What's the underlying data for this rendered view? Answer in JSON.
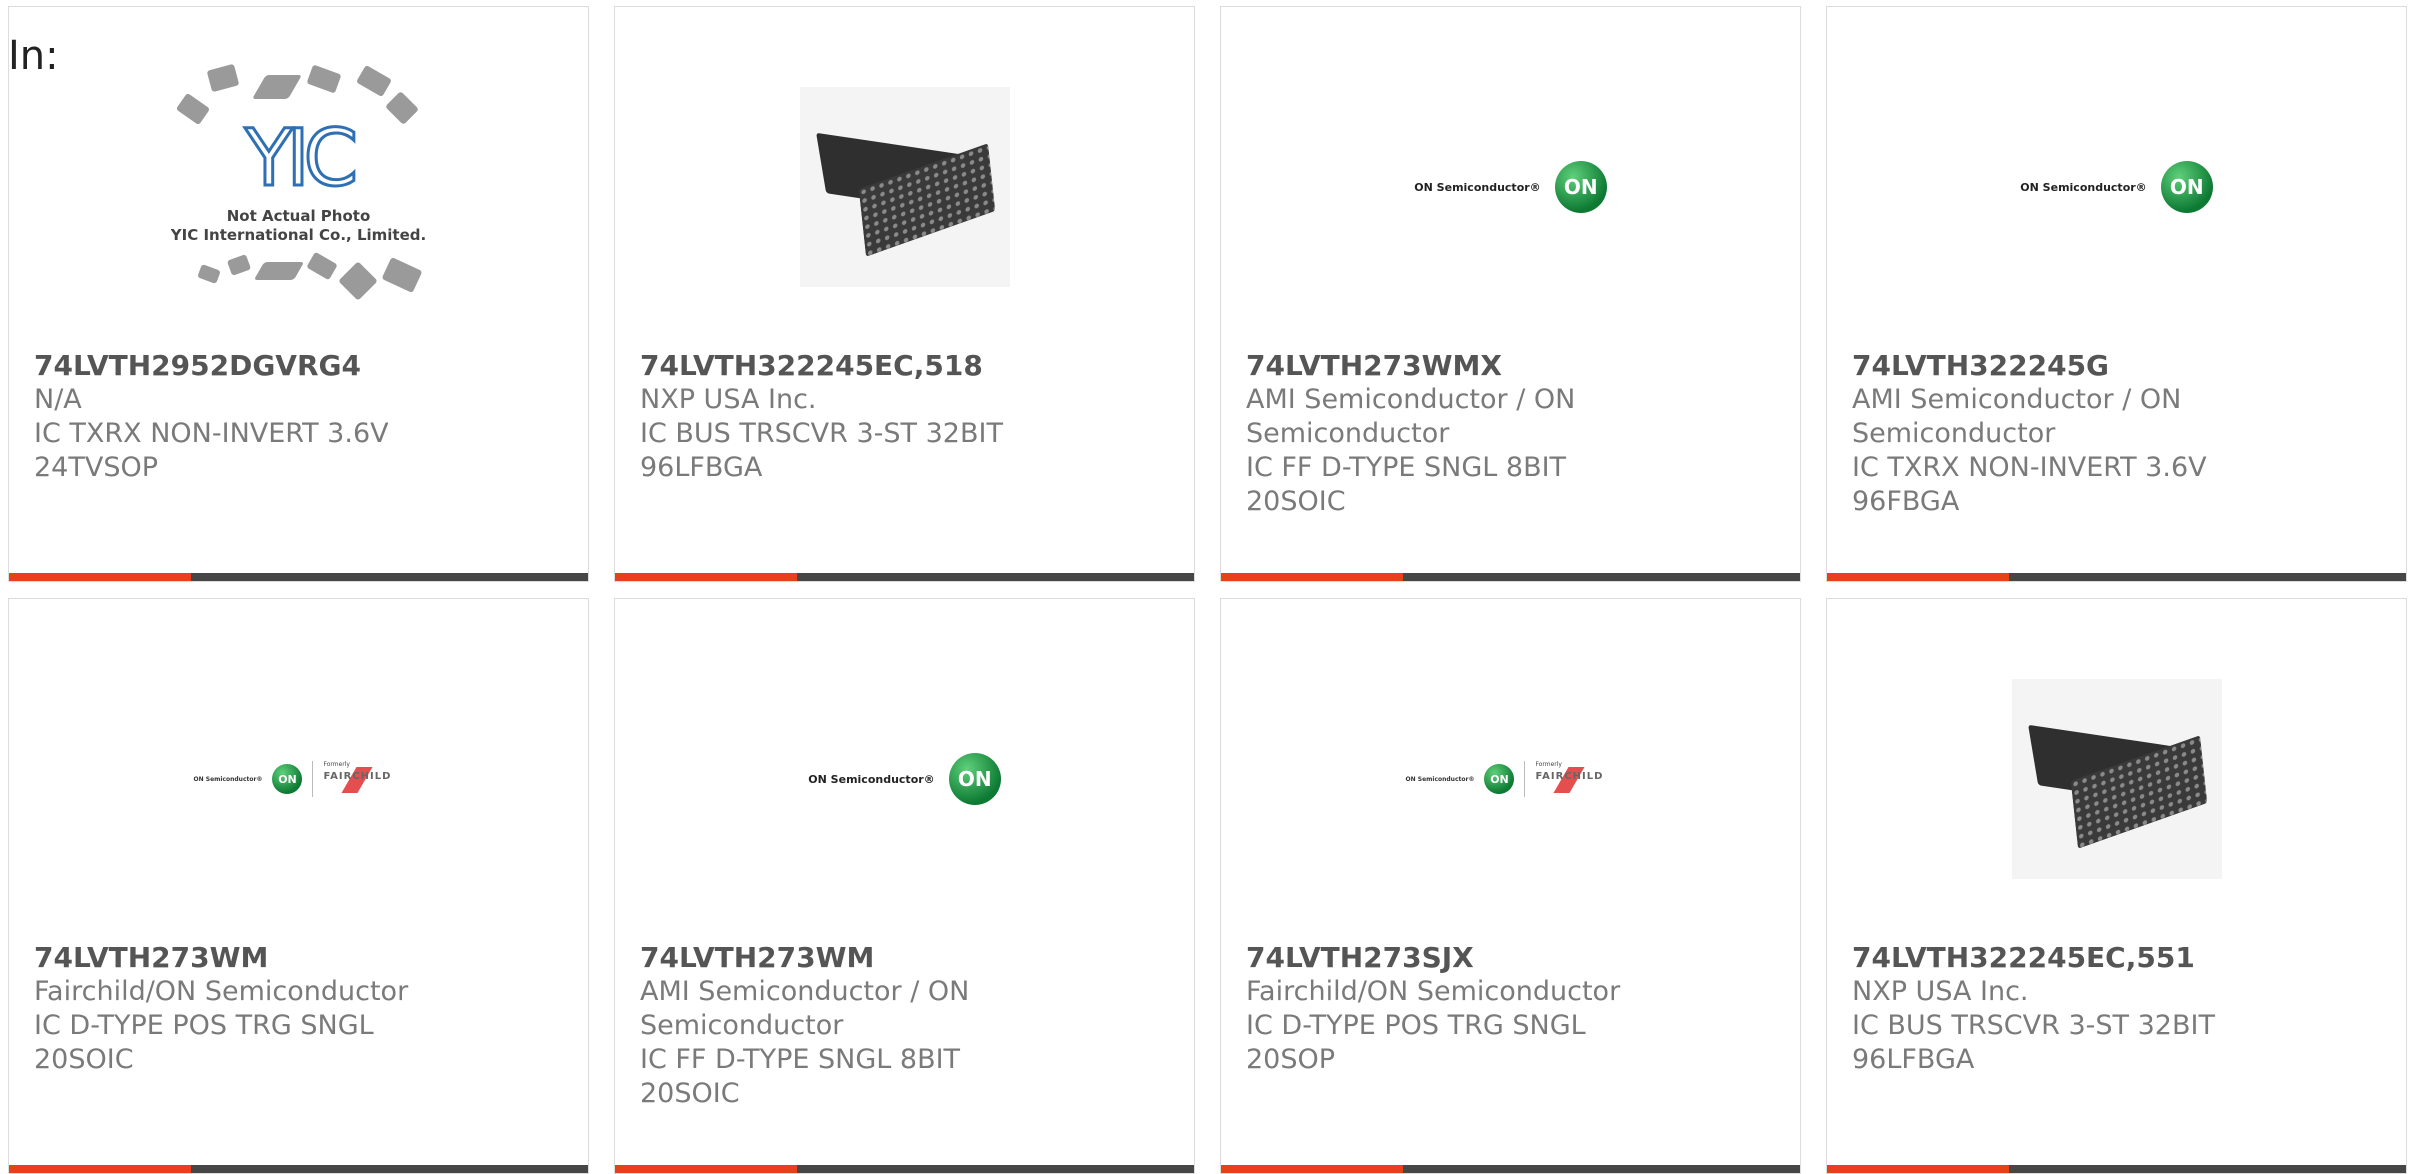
{
  "filter_label": "In:",
  "products": [
    {
      "part": "74LVTH2952DGVRG4",
      "maker": "N/A",
      "desc": "IC TXRX NON-INVERT 3.6V 24TVSOP",
      "image": "yic-placeholder",
      "placeholder_text": "Not Actual Photo\nYIC International Co., Limited.",
      "placeholder_logo": "YIC"
    },
    {
      "part": "74LVTH322245EC,518",
      "maker": "NXP USA Inc.",
      "desc": "IC BUS TRSCVR 3-ST 32BIT 96LFBGA",
      "image": "bga-package"
    },
    {
      "part": "74LVTH273WMX",
      "maker": "AMI Semiconductor / ON Semiconductor",
      "desc": "IC FF D-TYPE SNGL 8BIT 20SOIC",
      "image": "on-semi-logo"
    },
    {
      "part": "74LVTH322245G",
      "maker": "AMI Semiconductor / ON Semiconductor",
      "desc": "IC TXRX NON-INVERT 3.6V 96FBGA",
      "image": "on-semi-logo"
    },
    {
      "part": "74LVTH273WM",
      "maker": "Fairchild/ON Semiconductor",
      "desc": "IC D-TYPE POS TRG SNGL 20SOIC",
      "image": "on-fairchild-logo"
    },
    {
      "part": "74LVTH273WM",
      "maker": "AMI Semiconductor / ON Semiconductor",
      "desc": "IC FF D-TYPE SNGL 8BIT 20SOIC",
      "image": "on-semi-logo"
    },
    {
      "part": "74LVTH273SJX",
      "maker": "Fairchild/ON Semiconductor",
      "desc": "IC D-TYPE POS TRG SNGL 20SOP",
      "image": "on-fairchild-logo"
    },
    {
      "part": "74LVTH322245EC,551",
      "maker": "NXP USA Inc.",
      "desc": "IC BUS TRSCVR 3-ST 32BIT 96LFBGA",
      "image": "bga-package"
    }
  ],
  "logos": {
    "on_text": "ON Semiconductor®",
    "on_badge": "ON",
    "fairchild_formerly": "Formerly",
    "fairchild_name": "FAIRCHILD"
  },
  "colors": {
    "accent_orange": "#e8401c",
    "accent_dark": "#464646",
    "on_green": "#0d7a33"
  }
}
